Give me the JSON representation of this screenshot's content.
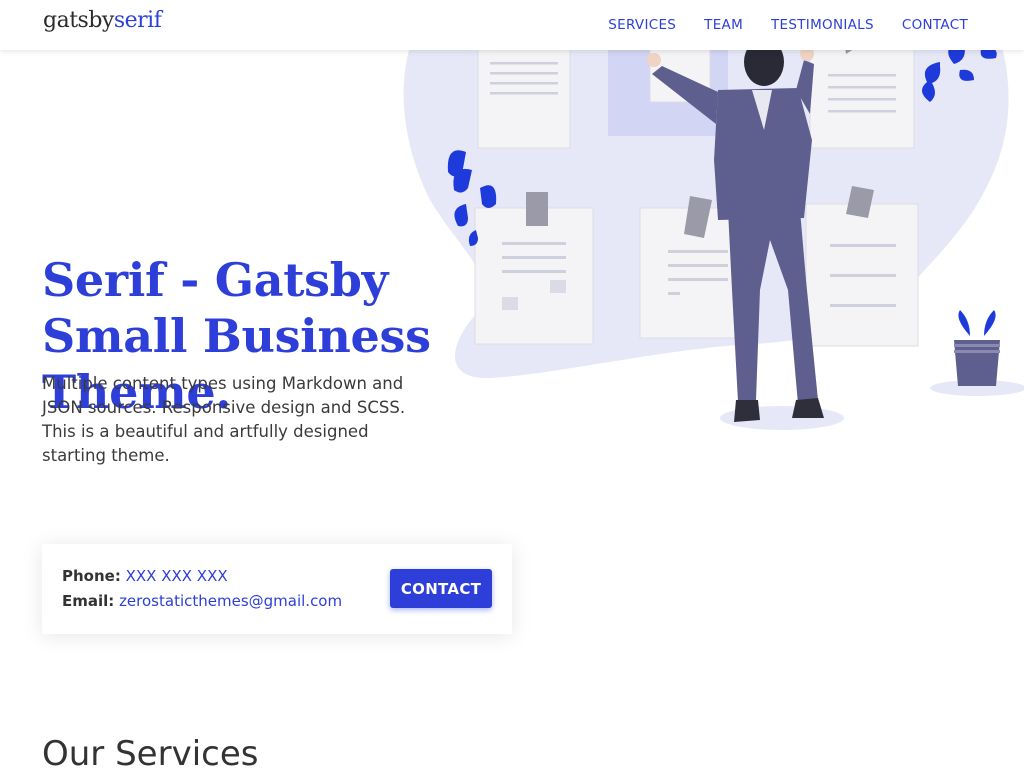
{
  "header": {
    "logo_part1": "gatsby",
    "logo_part2": "serif",
    "nav": [
      "SERVICES",
      "TEAM",
      "TESTIMONIALS",
      "CONTACT"
    ]
  },
  "hero": {
    "title": "Serif - Gatsby Small Business Theme.",
    "description": "Multiple content types using Markdown and JSON sources. Responsive design and SCSS. This is a beautiful and artfully designed starting theme."
  },
  "contact_card": {
    "phone_label": "Phone:",
    "phone_value": "XXX XXX XXX",
    "email_label": "Email:",
    "email_value": "zerostaticthemes@gmail.com",
    "button_label": "CONTACT"
  },
  "services": {
    "heading": "Our Services"
  },
  "colors": {
    "brand": "#2d3fd8",
    "blob": "#e6e8f8",
    "suit": "#5f5f8f",
    "leaf": "#1f3adb"
  }
}
